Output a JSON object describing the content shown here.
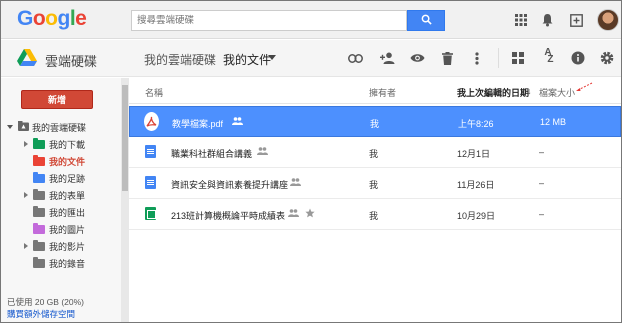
{
  "google": {
    "logo": [
      "G",
      "o",
      "o",
      "g",
      "l",
      "e"
    ],
    "search_placeholder": "搜尋雲端硬碟"
  },
  "drive": {
    "app_name": "雲端硬碟",
    "breadcrumb": [
      "我的雲端硬碟",
      "我的文件"
    ]
  },
  "sidebar": {
    "new_button": "新增",
    "root_label": "我的雲端硬碟",
    "items": [
      {
        "label": "我的下載",
        "color": "#0f9d58",
        "expandable": true,
        "active": false
      },
      {
        "label": "我的文件",
        "color": "#ea4335",
        "expandable": false,
        "active": true
      },
      {
        "label": "我的足跡",
        "color": "#4285f4",
        "expandable": false,
        "active": false
      },
      {
        "label": "我的表單",
        "color": "#777777",
        "expandable": true,
        "active": false
      },
      {
        "label": "我的匯出",
        "color": "#777777",
        "expandable": false,
        "active": false
      },
      {
        "label": "我的圖片",
        "color": "#c36adb",
        "expandable": false,
        "active": false
      },
      {
        "label": "我的影片",
        "color": "#777777",
        "expandable": true,
        "active": false
      },
      {
        "label": "我的錄音",
        "color": "#777777",
        "expandable": false,
        "active": false
      }
    ],
    "storage": "已使用 20 GB (20%)",
    "buy_storage": "購買額外儲存空間"
  },
  "list": {
    "headers": {
      "name": "名稱",
      "owner": "擁有者",
      "modified": "我上次編輯的日期",
      "sort_arrow": "↓",
      "size": "檔案大小"
    },
    "rows": [
      {
        "name": "教學檔案.pdf",
        "type": "pdf",
        "shared": true,
        "starred": false,
        "owner": "我",
        "modified": "上午8:26",
        "size": "12 MB",
        "selected": true
      },
      {
        "name": "職業科社群組合講義",
        "type": "doc",
        "shared": true,
        "starred": false,
        "owner": "我",
        "modified": "12月1日",
        "size": "–",
        "selected": false
      },
      {
        "name": "資訊安全與資訊素養提升講座",
        "type": "doc",
        "shared": true,
        "starred": false,
        "owner": "我",
        "modified": "11月26日",
        "size": "–",
        "selected": false
      },
      {
        "name": "213班計算機概論平時成績表",
        "type": "sheet",
        "shared": true,
        "starred": true,
        "owner": "我",
        "modified": "10月29日",
        "size": "–",
        "selected": false
      }
    ]
  },
  "icons": [
    "search-icon",
    "apps-icon",
    "notifications-icon",
    "share-plus-icon",
    "avatar",
    "drive-logo-icon",
    "link-icon",
    "add-person-icon",
    "preview-eye-icon",
    "trash-icon",
    "more-vert-icon",
    "grid-view-icon",
    "sort-az-icon",
    "info-icon",
    "settings-icon",
    "folder-icon",
    "shared-icon",
    "star-icon",
    "pdf-icon",
    "doc-icon",
    "sheet-icon"
  ],
  "colors": {
    "accent": "#4285f4",
    "new_button": "#d14836",
    "selected_row": "#4d90fe"
  }
}
